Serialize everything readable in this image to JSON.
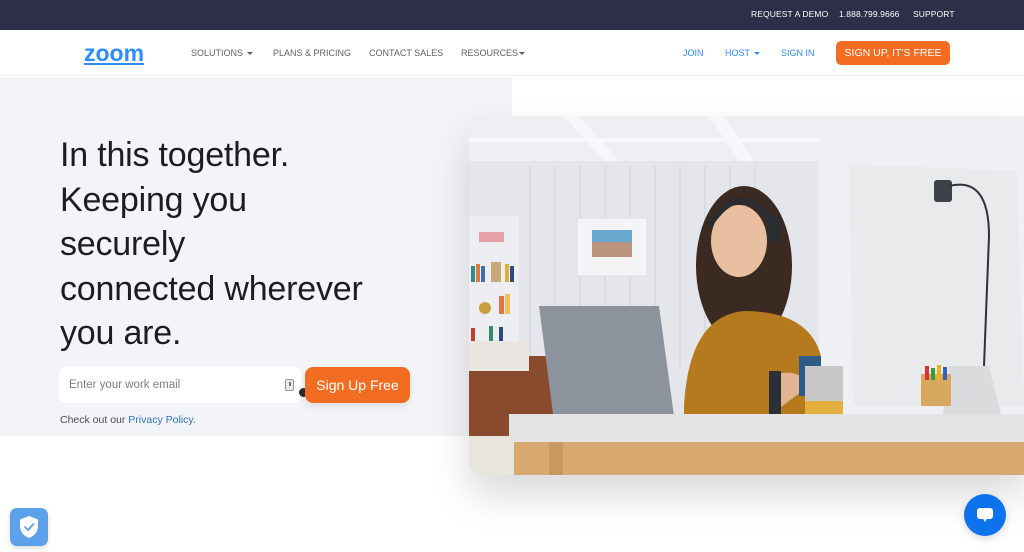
{
  "topbar": {
    "request_demo": "REQUEST A DEMO",
    "phone": "1.888.799.9666",
    "support": "SUPPORT"
  },
  "nav": {
    "logo": "zoom",
    "items": [
      {
        "label": "SOLUTIONS",
        "dropdown": true
      },
      {
        "label": "PLANS & PRICING",
        "dropdown": false
      },
      {
        "label": "CONTACT SALES",
        "dropdown": false
      },
      {
        "label": "RESOURCES",
        "dropdown": true
      }
    ],
    "right": {
      "join": "JOIN",
      "host": "HOST",
      "sign_in": "SIGN IN",
      "sign_up": "SIGN UP, IT'S FREE"
    }
  },
  "hero": {
    "headline_lines": [
      "In this together.",
      "Keeping you",
      "securely",
      "connected wherever",
      "you are."
    ],
    "email_placeholder": "Enter your work email",
    "email_value": "",
    "cta_label": "Sign Up Free",
    "privacy_prefix": "Check out our ",
    "privacy_link": "Privacy Policy",
    "privacy_suffix": "."
  },
  "photo": {
    "alt": "Woman with headset working on a laptop at a desk beside a desktop monitor"
  },
  "widgets": {
    "shield": "security-shield-icon",
    "chat": "chat-bubble-icon"
  },
  "colors": {
    "brand_blue": "#2d8cff",
    "accent_orange": "#f26d21",
    "topbar_bg": "#2d2e48",
    "hero_bg": "#f3f4f7",
    "chat_blue": "#0e72ed",
    "shield_blue": "#5da1ea"
  }
}
